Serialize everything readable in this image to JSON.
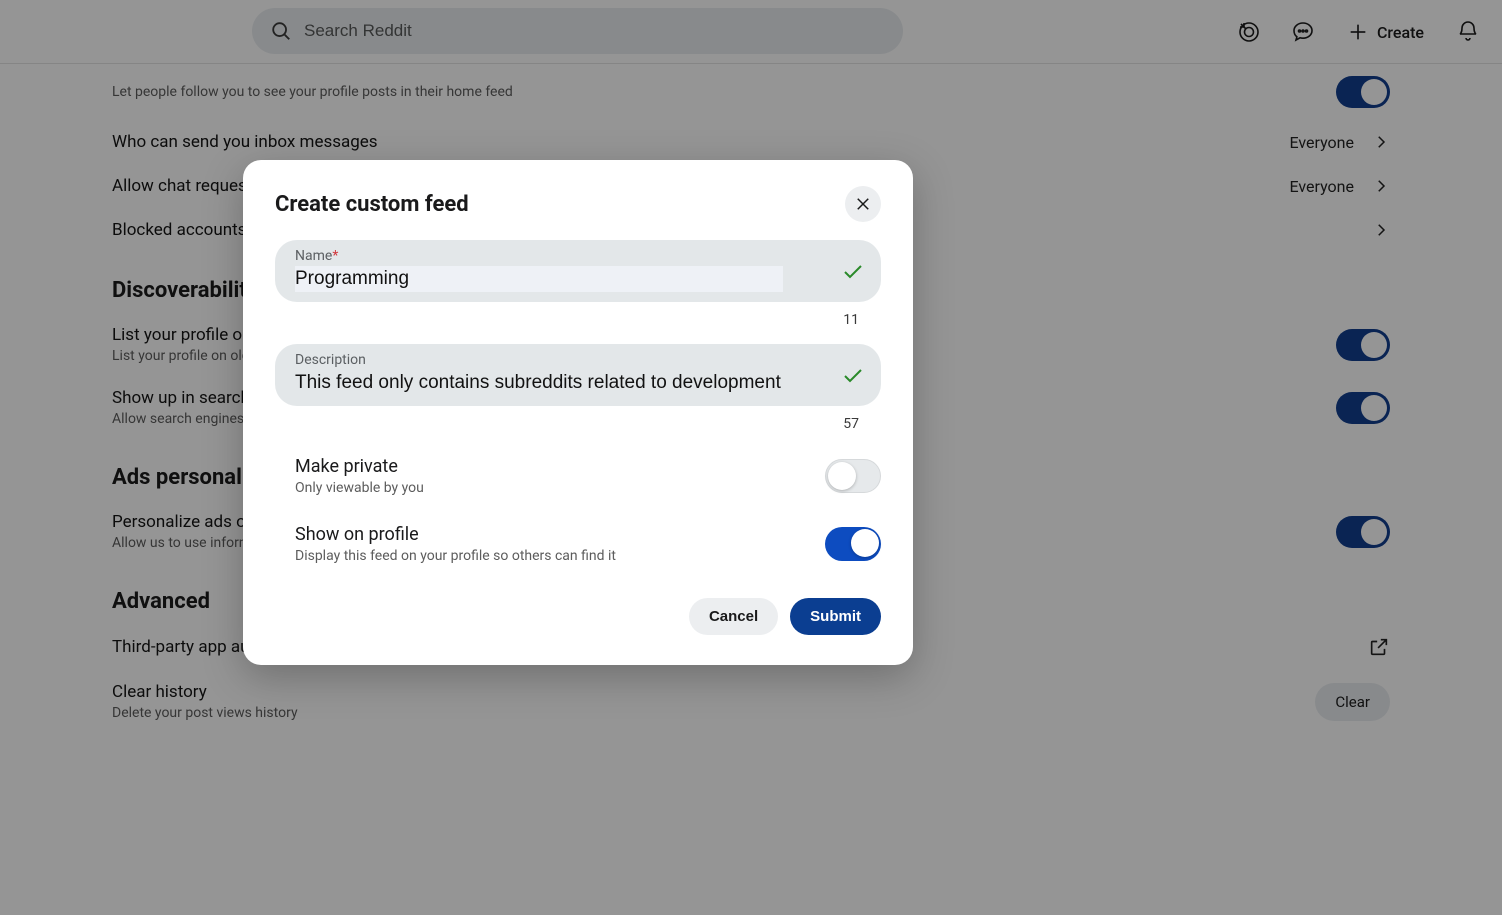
{
  "header": {
    "search_placeholder": "Search Reddit",
    "create_label": "Create"
  },
  "settings": {
    "follow_sub": "Let people follow you to see your profile posts in their home feed",
    "inbox_title": "Who can send you inbox messages",
    "inbox_value": "Everyone",
    "chat_title": "Allow chat requests",
    "chat_value": "Everyone",
    "blocked_title": "Blocked accounts",
    "discover_h": "Discoverability",
    "list_title": "List your profile on old Reddit",
    "list_sub": "List your profile on old.reddit.com",
    "search_title": "Show up in search results",
    "search_sub": "Allow search engines like Google to link to your profile",
    "ads_h": "Ads personalization",
    "ads_title": "Personalize ads on Reddit",
    "ads_sub": "Allow us to use information about your activity to show you more relevant ads",
    "adv_h": "Advanced",
    "third_title": "Third-party app authorizations",
    "clear_title": "Clear history",
    "clear_sub": "Delete your post views history",
    "clear_btn": "Clear"
  },
  "modal": {
    "title": "Create custom feed",
    "name_label": "Name",
    "name_value": "Programming",
    "name_count": "11",
    "desc_label": "Description",
    "desc_value": "This feed only contains subreddits related to development",
    "desc_count": "57",
    "private_title": "Make private",
    "private_sub": "Only viewable by you",
    "show_title": "Show on profile",
    "show_sub": "Display this feed on your profile so others can find it",
    "cancel": "Cancel",
    "submit": "Submit"
  }
}
